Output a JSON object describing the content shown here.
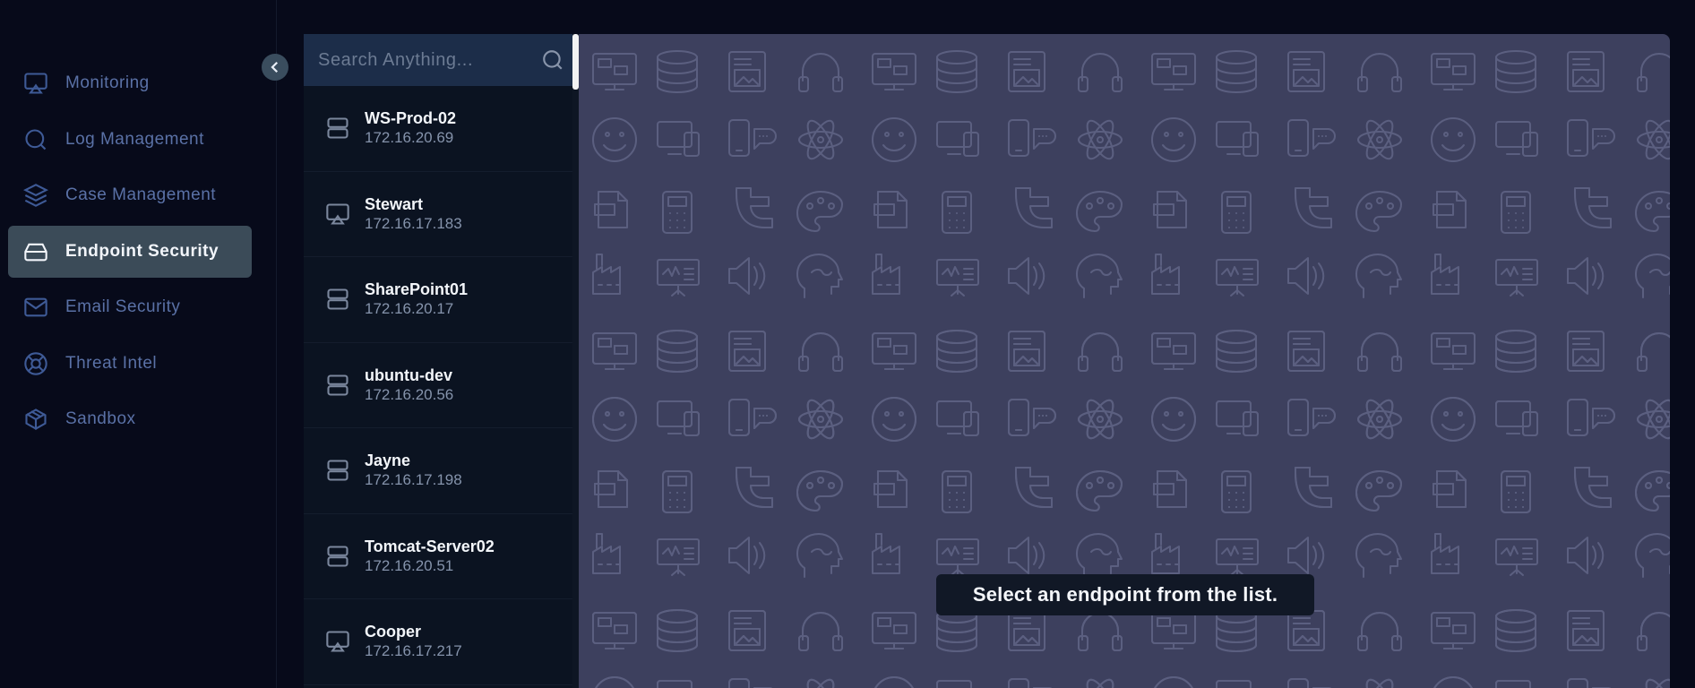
{
  "sidebar": {
    "collapse_icon": "chevron-left-icon",
    "items": [
      {
        "label": "Monitoring",
        "icon": "monitor-cast-icon",
        "active": false
      },
      {
        "label": "Log Management",
        "icon": "search-icon",
        "active": false
      },
      {
        "label": "Case Management",
        "icon": "layers-icon",
        "active": false
      },
      {
        "label": "Endpoint Security",
        "icon": "hard-drive-icon",
        "active": true
      },
      {
        "label": "Email Security",
        "icon": "mail-icon",
        "active": false
      },
      {
        "label": "Threat Intel",
        "icon": "lifebuoy-icon",
        "active": false
      },
      {
        "label": "Sandbox",
        "icon": "box-icon",
        "active": false
      }
    ]
  },
  "search": {
    "placeholder": "Search Anything...",
    "value": "",
    "icon": "search-icon"
  },
  "endpoints": [
    {
      "name": "WS-Prod-02",
      "ip": "172.16.20.69",
      "icon": "server-icon"
    },
    {
      "name": "Stewart",
      "ip": "172.16.17.183",
      "icon": "monitor-cast-icon"
    },
    {
      "name": "SharePoint01",
      "ip": "172.16.20.17",
      "icon": "server-icon"
    },
    {
      "name": "ubuntu-dev",
      "ip": "172.16.20.56",
      "icon": "server-icon"
    },
    {
      "name": "Jayne",
      "ip": "172.16.17.198",
      "icon": "server-icon"
    },
    {
      "name": "Tomcat-Server02",
      "ip": "172.16.20.51",
      "icon": "server-icon"
    },
    {
      "name": "Cooper",
      "ip": "172.16.17.217",
      "icon": "monitor-cast-icon"
    }
  ],
  "main": {
    "empty_message": "Select an endpoint from the list.",
    "background_color": "#3d405e"
  },
  "colors": {
    "app_bg": "#070a1a",
    "active_nav_bg": "#3b4b58",
    "nav_text": "#5a71a6",
    "list_bg": "#0b1321",
    "search_bg": "#1c2d49"
  }
}
